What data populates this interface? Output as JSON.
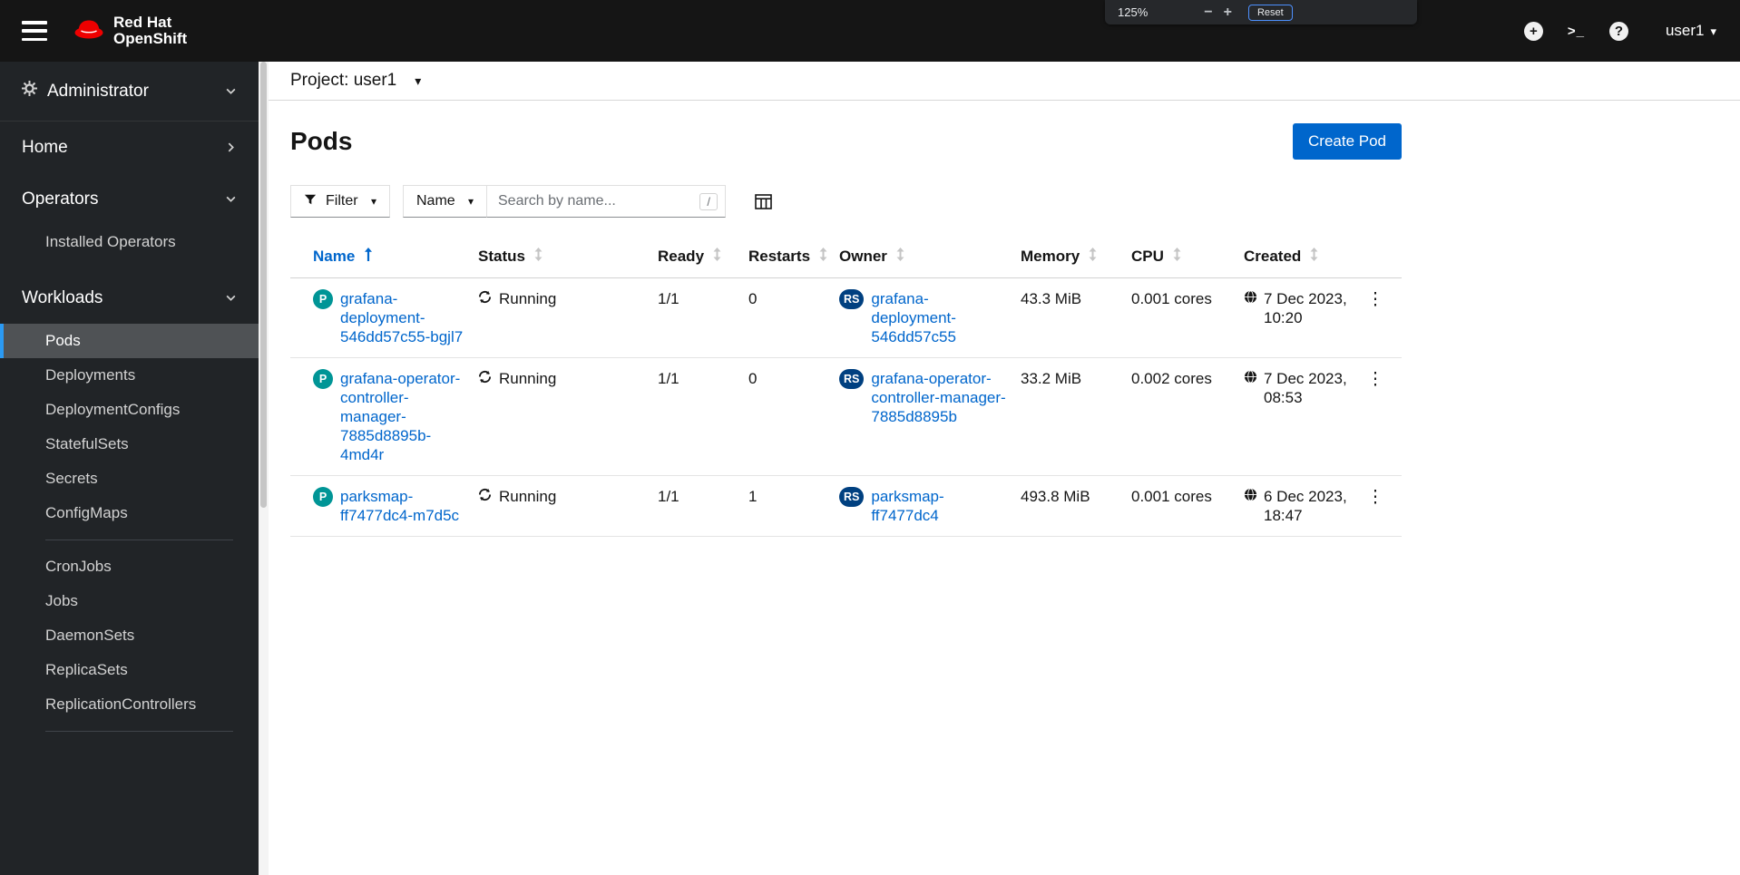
{
  "masthead": {
    "brand_line1": "Red Hat",
    "brand_line2": "OpenShift",
    "user": "user1"
  },
  "zoom_overlay": {
    "level": "125%",
    "reset_label": "Reset"
  },
  "sidebar": {
    "perspective": "Administrator",
    "home": "Home",
    "operators": {
      "label": "Operators",
      "items": [
        "Installed Operators"
      ]
    },
    "workloads": {
      "label": "Workloads",
      "active_item": "Pods",
      "items": [
        "Pods",
        "Deployments",
        "DeploymentConfigs",
        "StatefulSets",
        "Secrets",
        "ConfigMaps",
        "CronJobs",
        "Jobs",
        "DaemonSets",
        "ReplicaSets",
        "ReplicationControllers"
      ]
    }
  },
  "project_bar": {
    "label": "Project:",
    "value": "user1"
  },
  "page": {
    "title": "Pods",
    "create_button_label": "Create Pod"
  },
  "toolbar": {
    "filter_label": "Filter",
    "attribute_selected": "Name",
    "search_placeholder": "Search by name...",
    "search_shortcut": "/"
  },
  "table": {
    "columns": {
      "name": "Name",
      "status": "Status",
      "ready": "Ready",
      "restarts": "Restarts",
      "owner": "Owner",
      "memory": "Memory",
      "cpu": "CPU",
      "created": "Created"
    },
    "badge_pod": "P",
    "badge_replicaset": "RS",
    "rows": [
      {
        "name": "grafana-deployment-546dd57c55-bgjl7",
        "status": "Running",
        "ready": "1/1",
        "restarts": "0",
        "owner": "grafana-deployment-546dd57c55",
        "memory": "43.3 MiB",
        "cpu": "0.001 cores",
        "created": "7 Dec 2023, 10:20"
      },
      {
        "name": "grafana-operator-controller-manager-7885d8895b-4md4r",
        "status": "Running",
        "ready": "1/1",
        "restarts": "0",
        "owner": "grafana-operator-controller-manager-7885d8895b",
        "memory": "33.2 MiB",
        "cpu": "0.002 cores",
        "created": "7 Dec 2023, 08:53"
      },
      {
        "name": "parksmap-ff7477dc4-m7d5c",
        "status": "Running",
        "ready": "1/1",
        "restarts": "1",
        "owner": "parksmap-ff7477dc4",
        "memory": "493.8 MiB",
        "cpu": "0.001 cores",
        "created": "6 Dec 2023, 18:47"
      }
    ]
  },
  "icons": {
    "nav_toggle": "hamburger",
    "brand": "redhat-fedora",
    "masthead_actions": [
      "plus-circle",
      "terminal",
      "question-circle"
    ],
    "perspective": "gear",
    "filter": "funnel",
    "column_management": "table-columns",
    "sort_unsorted": "arrows-up-down",
    "sort_ascending": "arrow-up",
    "status_running": "sync",
    "created": "globe",
    "row_actions": "kebab"
  },
  "colors": {
    "brand_red": "#ee0000",
    "accent_blue": "#0066cc",
    "pod_badge": "#009596",
    "replicaset_badge": "#004080",
    "sidebar_active_indicator": "#2b9af3"
  }
}
